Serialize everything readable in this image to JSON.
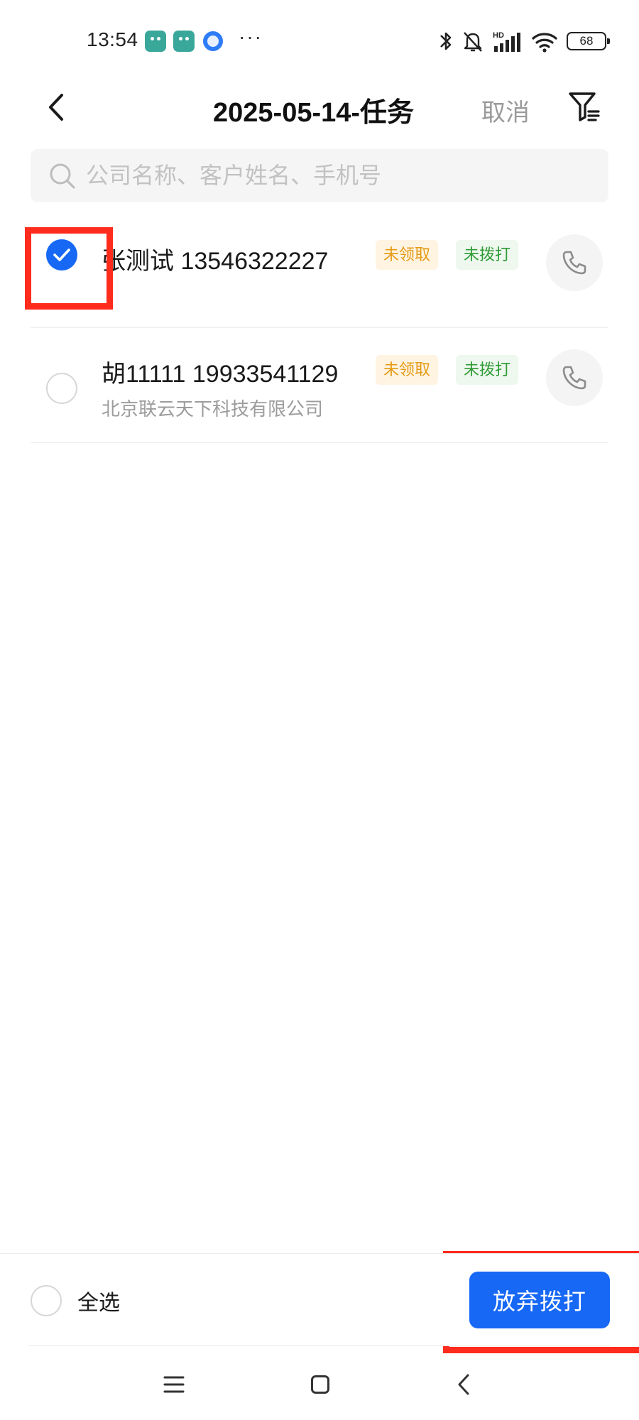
{
  "status_bar": {
    "time": "13:54",
    "icons": [
      "android-app-icon",
      "android-app-icon",
      "browser-app-icon",
      "more-dots-icon",
      "bluetooth-icon",
      "bell-muted-icon",
      "signal-hd-icon",
      "wifi-icon",
      "battery-icon"
    ],
    "more": "···",
    "battery": "68"
  },
  "header": {
    "title": "2025-05-14-任务",
    "cancel_label": "取消"
  },
  "search": {
    "placeholder": "公司名称、客户姓名、手机号"
  },
  "list": {
    "items": [
      {
        "title": "张测试 13546322227",
        "subtitle": "",
        "selected": true,
        "tags": [
          "未领取",
          "未拨打"
        ]
      },
      {
        "title": "胡11111 19933541129",
        "subtitle": "北京联云天下科技有限公司",
        "selected": false,
        "tags": [
          "未领取",
          "未拨打"
        ]
      }
    ]
  },
  "bottom_bar": {
    "select_all_label": "全选",
    "abandon_label": "放弃拨打"
  },
  "colors": {
    "accent": "#1668f5",
    "highlight": "#ff2b1c",
    "tag_orange_text": "#e59a13",
    "tag_orange_bg": "#fff4e2",
    "tag_green_text": "#2f9a36",
    "tag_green_bg": "#eef8ee"
  }
}
